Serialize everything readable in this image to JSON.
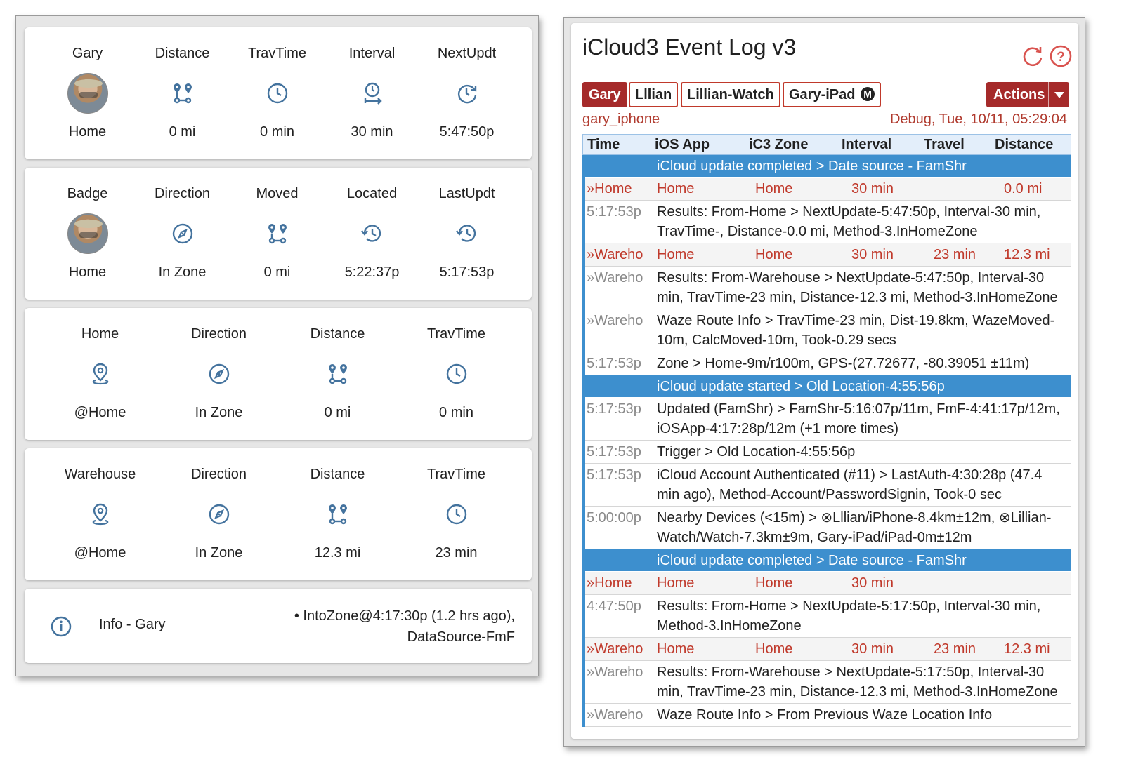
{
  "left": {
    "card1": {
      "columns": [
        {
          "label": "Gary",
          "icon": "avatar",
          "value": "Home"
        },
        {
          "label": "Distance",
          "icon": "route-icon",
          "value": "0 mi"
        },
        {
          "label": "TravTime",
          "icon": "clock-icon",
          "value": "0 min"
        },
        {
          "label": "Interval",
          "icon": "timer-arrow-icon",
          "value": "30 min"
        },
        {
          "label": "NextUpdt",
          "icon": "clock-refresh-icon",
          "value": "5:47:50p"
        }
      ]
    },
    "card2": {
      "columns": [
        {
          "label": "Badge",
          "icon": "avatar",
          "value": "Home"
        },
        {
          "label": "Direction",
          "icon": "compass-icon",
          "value": "In Zone"
        },
        {
          "label": "Moved",
          "icon": "route-icon",
          "value": "0 mi"
        },
        {
          "label": "Located",
          "icon": "history-icon",
          "value": "5:22:37p"
        },
        {
          "label": "LastUpdt",
          "icon": "history-icon",
          "value": "5:17:53p"
        }
      ]
    },
    "card3": {
      "columns": [
        {
          "label": "Home",
          "icon": "map-pin-icon",
          "value": "@Home"
        },
        {
          "label": "Direction",
          "icon": "compass-icon",
          "value": "In Zone"
        },
        {
          "label": "Distance",
          "icon": "route-icon",
          "value": "0 mi"
        },
        {
          "label": "TravTime",
          "icon": "clock-icon",
          "value": "0 min"
        }
      ]
    },
    "card4": {
      "columns": [
        {
          "label": "Warehouse",
          "icon": "map-pin-icon",
          "value": "@Home"
        },
        {
          "label": "Direction",
          "icon": "compass-icon",
          "value": "In Zone"
        },
        {
          "label": "Distance",
          "icon": "route-icon",
          "value": "12.3 mi"
        },
        {
          "label": "TravTime",
          "icon": "clock-icon",
          "value": "23 min"
        }
      ]
    },
    "info": {
      "label": "Info - Gary",
      "line1": "• IntoZone@4:17:30p (1.2 hrs ago),",
      "line2": "DataSource-FmF"
    }
  },
  "log": {
    "title": "iCloud3 Event Log v3",
    "devices": [
      "Gary",
      "Lllian",
      "Lillian-Watch",
      "Gary-iPad"
    ],
    "ipad_badge": "M",
    "actions_label": "Actions",
    "device_id": "gary_iphone",
    "debug_line": "Debug, Tue, 10/11, 05:29:04",
    "columns": [
      "Time",
      "iOS App",
      "iC3 Zone",
      "Interval",
      "Travel",
      "Distance"
    ],
    "rows": [
      {
        "kind": "band",
        "text": "iCloud update completed > Date source - FamShr"
      },
      {
        "kind": "red",
        "time": "»Home",
        "app": "Home",
        "zone": "Home",
        "interval": "30 min",
        "travel": "",
        "distance": "0.0 mi"
      },
      {
        "kind": "msg",
        "time": "5:17:53p",
        "lines": [
          "Results: From-Home > NextUpdate-5:47:50p, Interval-30 min,",
          "TravTime-, Distance-0.0 mi, Method-3.InHomeZone"
        ]
      },
      {
        "kind": "red",
        "time": "»Wareho",
        "app": "Home",
        "zone": "Home",
        "interval": "30 min",
        "travel": "23 min",
        "distance": "12.3 mi"
      },
      {
        "kind": "msg",
        "time": "»Wareho",
        "lines": [
          "Results: From-Warehouse > NextUpdate-5:47:50p, Interval-30",
          "min, TravTime-23 min, Distance-12.3 mi, Method-3.InHomeZone"
        ]
      },
      {
        "kind": "msg",
        "time": "»Wareho",
        "lines": [
          "Waze Route Info > TravTime-23 min, Dist-19.8km, WazeMoved-",
          "10m, CalcMoved-10m, Took-0.29 secs"
        ]
      },
      {
        "kind": "msg",
        "time": "5:17:53p",
        "lines": [
          "Zone > Home-9m/r100m, GPS-(27.72677, -80.39051 ±11m)"
        ]
      },
      {
        "kind": "band",
        "text": "iCloud update started > Old Location-4:55:56p"
      },
      {
        "kind": "msg",
        "time": "5:17:53p",
        "lines": [
          "Updated (FamShr) > FamShr-5:16:07p/11m, FmF-4:41:17p/12m,",
          "iOSApp-4:17:28p/12m (+1 more times)"
        ]
      },
      {
        "kind": "msg",
        "time": "5:17:53p",
        "lines": [
          "Trigger > Old Location-4:55:56p"
        ]
      },
      {
        "kind": "msg",
        "time": "5:17:53p",
        "lines": [
          "iCloud Account Authenticated (#11) > LastAuth-4:30:28p (47.4",
          "min ago), Method-Account/PasswordSignin, Took-0 sec"
        ]
      },
      {
        "kind": "msg",
        "time": "5:00:00p",
        "lines": [
          "Nearby Devices (<15m) > ⊗Lllian/iPhone-8.4km±12m, ⊗Lillian-",
          "Watch/Watch-7.3km±9m, Gary-iPad/iPad-0m±12m"
        ]
      },
      {
        "kind": "band",
        "text": "iCloud update completed > Date source - FamShr"
      },
      {
        "kind": "red",
        "time": "»Home",
        "app": "Home",
        "zone": "Home",
        "interval": "30 min",
        "travel": "",
        "distance": ""
      },
      {
        "kind": "msg",
        "time": "4:47:50p",
        "lines": [
          "Results: From-Home > NextUpdate-5:17:50p, Interval-30 min,",
          "Method-3.InHomeZone"
        ]
      },
      {
        "kind": "red",
        "time": "»Wareho",
        "app": "Home",
        "zone": "Home",
        "interval": "30 min",
        "travel": "23 min",
        "distance": "12.3 mi"
      },
      {
        "kind": "msg",
        "time": "»Wareho",
        "lines": [
          "Results: From-Warehouse > NextUpdate-5:17:50p, Interval-30",
          "min, TravTime-23 min, Distance-12.3 mi, Method-3.InHomeZone"
        ]
      },
      {
        "kind": "msg",
        "time": "»Wareho",
        "lines": [
          "Waze Route Info > From Previous Waze Location Info"
        ]
      }
    ]
  },
  "colors": {
    "icon": "#44739e",
    "accent": "#a52a2a",
    "band": "#3d8fce",
    "red_text": "#c0392b"
  }
}
